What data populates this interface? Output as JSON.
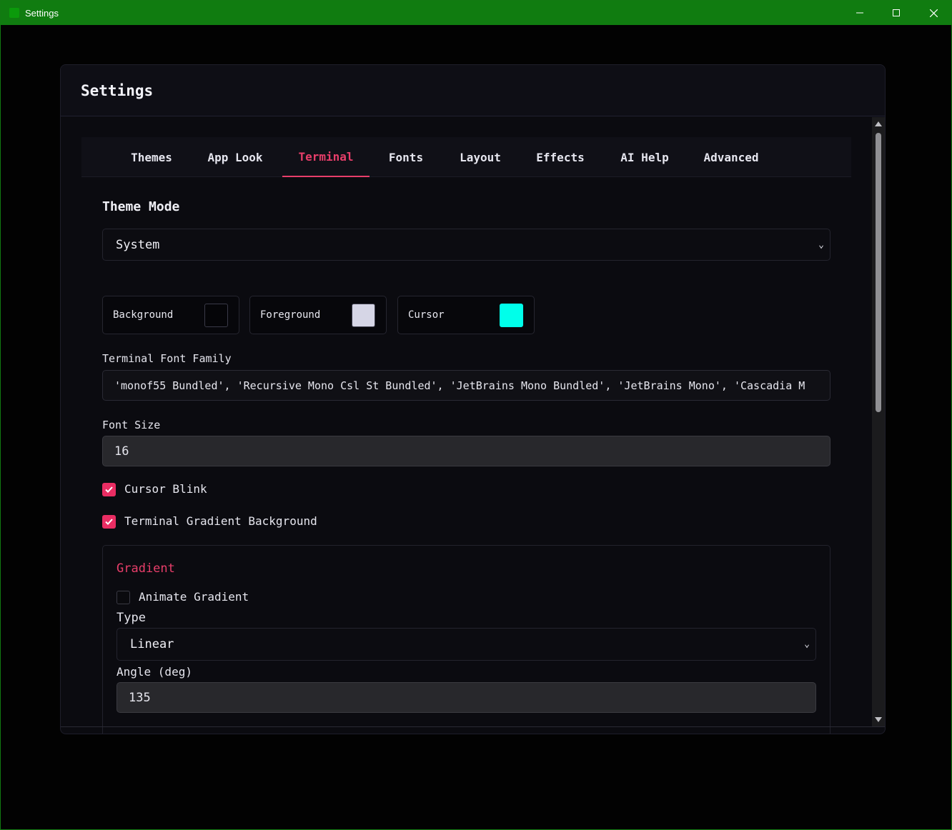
{
  "window": {
    "title": "Settings",
    "colors": {
      "titlebar": "#107c10",
      "accent": "#e83e6a"
    }
  },
  "dialog": {
    "title": "Settings"
  },
  "tabs": [
    {
      "label": "Themes"
    },
    {
      "label": "App Look"
    },
    {
      "label": "Terminal",
      "active": true
    },
    {
      "label": "Fonts"
    },
    {
      "label": "Layout"
    },
    {
      "label": "Effects"
    },
    {
      "label": "AI Help"
    },
    {
      "label": "Advanced"
    }
  ],
  "theme_mode": {
    "title": "Theme Mode",
    "value": "System"
  },
  "colors": [
    {
      "label": "Background",
      "swatch": "#050508"
    },
    {
      "label": "Foreground",
      "swatch": "#d6d6e6"
    },
    {
      "label": "Cursor",
      "swatch": "#00ffea"
    }
  ],
  "font_family": {
    "label": "Terminal Font Family",
    "value": "'monof55 Bundled', 'Recursive Mono Csl St Bundled', 'JetBrains Mono Bundled', 'JetBrains Mono', 'Cascadia M"
  },
  "font_size": {
    "label": "Font Size",
    "value": "16"
  },
  "cursor_blink": {
    "label": "Cursor Blink",
    "checked": true
  },
  "gradient_bg": {
    "label": "Terminal Gradient Background",
    "checked": true
  },
  "gradient": {
    "title": "Gradient",
    "animate": {
      "label": "Animate Gradient",
      "checked": false
    },
    "type_label": "Type",
    "type_value": "Linear",
    "angle_label": "Angle (deg)",
    "angle_value": "135"
  }
}
